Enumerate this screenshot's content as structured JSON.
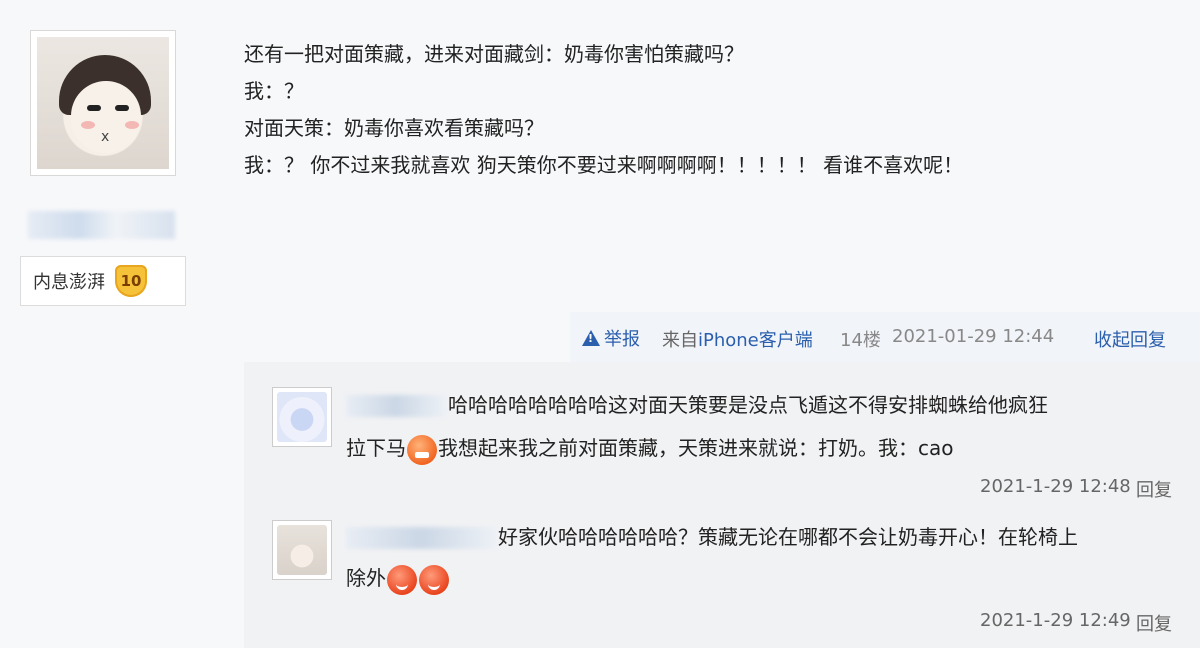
{
  "user": {
    "badge_text": "内息澎湃",
    "badge_level": "10"
  },
  "post": {
    "lines": [
      "还有一把对面策藏，进来对面藏剑：奶毒你害怕策藏吗？",
      "我：？",
      "对面天策：奶毒你喜欢看策藏吗？",
      "我：？ 你不过来我就喜欢 狗天策你不要过来啊啊啊啊！！！！！ 看谁不喜欢呢！"
    ]
  },
  "actions": {
    "report_label": "举报",
    "source_prefix": "来自",
    "source_link": "iPhone客户端",
    "floor": "14楼",
    "datetime": "2021-01-29 12:44",
    "collapse_label": "收起回复"
  },
  "replies": [
    {
      "line1": "哈哈哈哈哈哈哈哈这对面天策要是没点飞遁这不得安排蜘蛛给他疯狂",
      "line2_pre": "拉下马",
      "line2_post": "我想起来我之前对面策藏，天策进来就说：打奶。我：cao",
      "emoji": "angry-face-icon",
      "time": "2021-1-29 12:48",
      "reply_label": "回复"
    },
    {
      "line1": "好家伙哈哈哈哈哈哈？策藏无论在哪都不会让奶毒开心！在轮椅上",
      "line2_pre": "除外",
      "emoji": "smile-face-icon",
      "time": "2021-1-29 12:49",
      "reply_label": "回复"
    }
  ]
}
